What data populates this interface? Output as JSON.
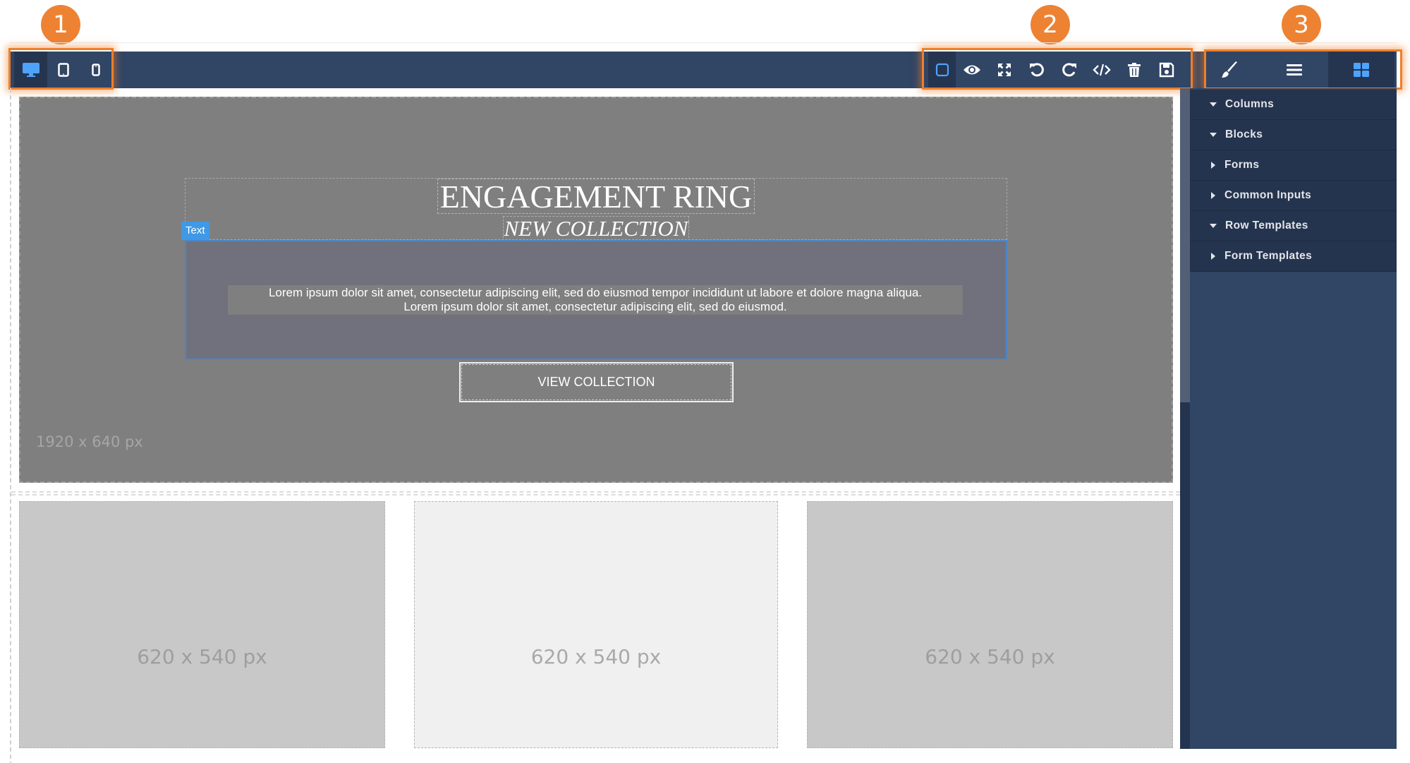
{
  "callouts": [
    "1",
    "2",
    "3"
  ],
  "device_toolbar": {
    "buttons": [
      {
        "name": "desktop",
        "icon": "monitor-icon",
        "active": true
      },
      {
        "name": "tablet",
        "icon": "tablet-icon",
        "active": false
      },
      {
        "name": "mobile",
        "icon": "mobile-icon",
        "active": false
      }
    ]
  },
  "actions_toolbar": {
    "buttons": [
      {
        "name": "component-outline",
        "icon": "square-outline-icon",
        "active": true
      },
      {
        "name": "preview",
        "icon": "eye-icon",
        "active": false
      },
      {
        "name": "fullscreen",
        "icon": "expand-arrows-icon",
        "active": false
      },
      {
        "name": "undo",
        "icon": "undo-icon",
        "active": false
      },
      {
        "name": "redo",
        "icon": "redo-icon",
        "active": false
      },
      {
        "name": "view-code",
        "icon": "code-icon",
        "active": false
      },
      {
        "name": "clear-canvas",
        "icon": "trash-icon",
        "active": false
      },
      {
        "name": "save",
        "icon": "floppy-disk-icon",
        "active": false
      }
    ]
  },
  "panel_tabs": [
    {
      "name": "style-manager",
      "icon": "paint-brush-icon",
      "active": false
    },
    {
      "name": "layer-manager",
      "icon": "bars-icon",
      "active": false
    },
    {
      "name": "blocks",
      "icon": "grid-icon",
      "active": true
    }
  ],
  "block_categories": [
    {
      "label": "Columns",
      "expanded": true
    },
    {
      "label": "Blocks",
      "expanded": true
    },
    {
      "label": "Forms",
      "expanded": false
    },
    {
      "label": "Common Inputs",
      "expanded": false
    },
    {
      "label": "Row Templates",
      "expanded": true
    },
    {
      "label": "Form Templates",
      "expanded": false
    }
  ],
  "hero": {
    "title": "ENGAGEMENT RING",
    "subtitle": "NEW COLLECTION",
    "selected_tag": "Text",
    "body_line1": "Lorem ipsum dolor sit amet, consectetur adipiscing elit, sed do eiusmod tempor incididunt ut labore et dolore magna aliqua.",
    "body_line2": "Lorem ipsum dolor sit amet, consectetur adipiscing elit, sed do eiusmod.",
    "button_label": "VIEW COLLECTION",
    "placeholder_size": "1920 x 640 px"
  },
  "image_placeholders": [
    {
      "label": "620 x 540 px"
    },
    {
      "label": "620 x 540 px"
    },
    {
      "label": "620 x 540 px"
    }
  ],
  "colors": {
    "toolbar_bg": "#314565",
    "toolbar_active": "#26354f",
    "icon_active": "#4ea3ff",
    "callout_orange": "#ee8233",
    "selection_blue": "#3f99e6"
  }
}
